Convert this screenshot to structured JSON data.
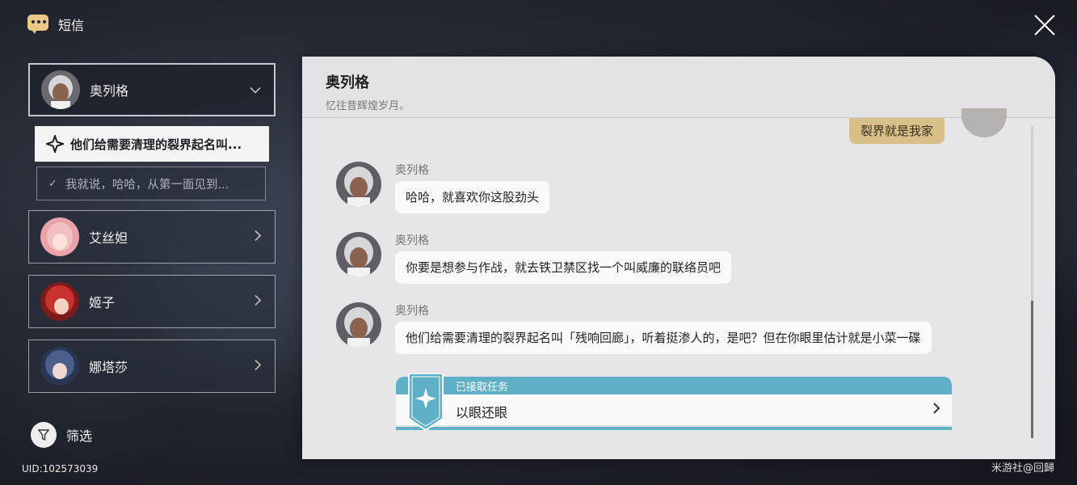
{
  "app": {
    "title": "短信"
  },
  "contacts": [
    {
      "name": "奥列格",
      "expanded": true
    },
    {
      "name": "艾丝妲",
      "expanded": false
    },
    {
      "name": "姬子",
      "expanded": false
    },
    {
      "name": "娜塔莎",
      "expanded": false
    }
  ],
  "threads": [
    {
      "label": "他们给需要清理的裂界起名叫...",
      "state": "selected"
    },
    {
      "label": "我就说，哈哈，从第一面见到...",
      "state": "done"
    }
  ],
  "filter": {
    "label": "筛选"
  },
  "uid": "UID:102573039",
  "watermark": "米游社@回歸",
  "chat": {
    "title": "奥列格",
    "subtitle": "忆往昔辉煌岁月。",
    "my_message": "裂界就是我家",
    "messages": [
      {
        "sender": "奥列格",
        "text": "哈哈，就喜欢你这股劲头"
      },
      {
        "sender": "奥列格",
        "text": "你要是想参与作战，就去铁卫禁区找一个叫威廉的联络员吧"
      },
      {
        "sender": "奥列格",
        "text": "他们给需要清理的裂界起名叫「残响回廊」，听着挺渗人的，是吧？但在你眼里估计就是小菜一碟"
      }
    ],
    "quest": {
      "tag": "已接取任务",
      "name": "以眼还眼"
    }
  },
  "colors": {
    "quest_accent": "#5fb0c6",
    "my_bubble": "#d8c08a",
    "icon_gold": "#e8c98a"
  }
}
